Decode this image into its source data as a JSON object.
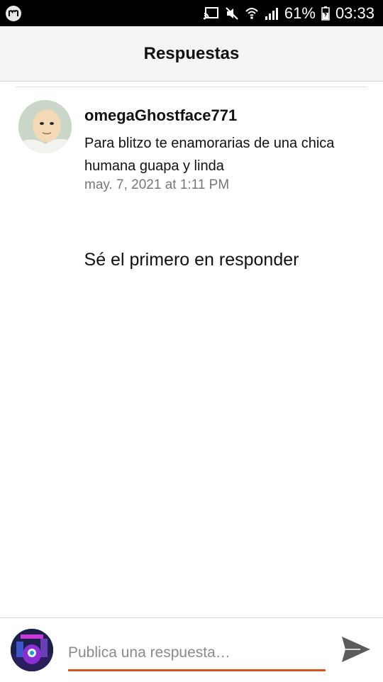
{
  "status_bar": {
    "battery": "61%",
    "time": "03:33",
    "icons": [
      "cast-icon",
      "mute-icon",
      "wifi-icon",
      "signal-icon",
      "battery-icon"
    ]
  },
  "header": {
    "title": "Respuestas"
  },
  "comment": {
    "author": "omegaGhostface771",
    "text": "Para blitzo te enamorarias de una chica humana guapa y linda",
    "date": "may. 7, 2021 at 1:11 PM"
  },
  "empty_state": "Sé el primero en responder",
  "reply": {
    "placeholder": "Publica una respuesta…",
    "value": ""
  },
  "colors": {
    "accent": "#d9531e",
    "header_bg": "#f5f5f5",
    "status_bar_bg": "#000000"
  }
}
